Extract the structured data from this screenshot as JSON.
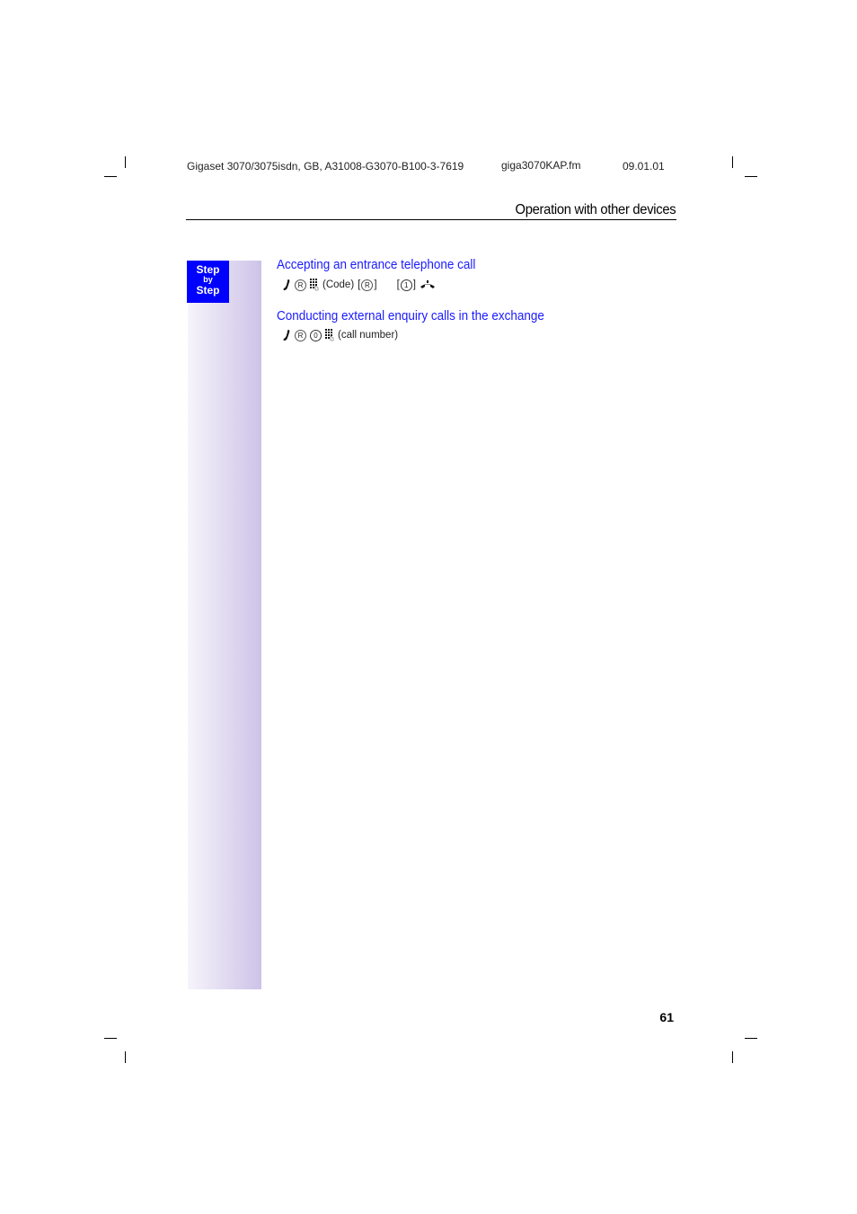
{
  "header": {
    "doc_id": "Gigaset 3070/3075isdn, GB, A31008-G3070-B100-3-7619",
    "file_name": "giga3070KAP.fm",
    "date": "09.01.01"
  },
  "section_title": "Operation with other devices",
  "step_box": {
    "line1": "Step",
    "line2": "by",
    "line3": "Step",
    "color": "#0000ff"
  },
  "sections": [
    {
      "heading": "Accepting an entrance telephone call",
      "sequence": {
        "icons": [
          "lift-handset-icon",
          "recall-key-icon",
          "keypad-icon"
        ],
        "code_label": "(Code)",
        "bracket_open": "[",
        "bracket_close": "]",
        "recall_glyph": "R",
        "key1_glyph": "1",
        "trailing_icons": [
          "hang-up-icon"
        ]
      }
    },
    {
      "heading": "Conducting external enquiry calls in the exchange",
      "sequence": {
        "icons": [
          "lift-handset-icon",
          "recall-key-icon",
          "key-0-icon",
          "keypad-icon"
        ],
        "recall_glyph": "R",
        "key0_glyph": "0",
        "number_label": "(call number)"
      }
    }
  ],
  "page_number": "61",
  "colors": {
    "heading": "#1a1aff",
    "sidebar_gradient_end": "#cdc3e8"
  }
}
